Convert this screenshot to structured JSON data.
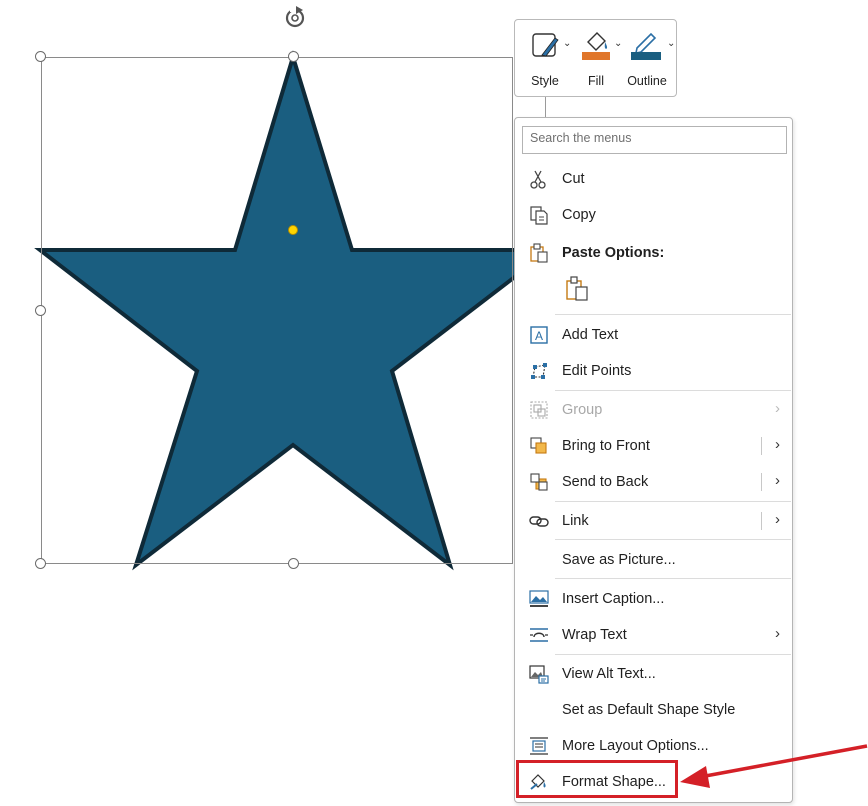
{
  "mini_toolbar": {
    "style_label": "Style",
    "fill_label": "Fill",
    "outline_label": "Outline"
  },
  "menu": {
    "search_placeholder": "Search the menus",
    "items": {
      "cut": "Cut",
      "copy": "Copy",
      "paste_options": "Paste Options:",
      "add_text": "Add Text",
      "edit_points": "Edit Points",
      "group": "Group",
      "bring_to_front": "Bring to Front",
      "send_to_back": "Send to Back",
      "link": "Link",
      "save_as_picture": "Save as Picture...",
      "insert_caption": "Insert Caption...",
      "wrap_text": "Wrap Text",
      "view_alt_text": "View Alt Text...",
      "set_default_shape_style": "Set as Default Shape Style",
      "more_layout_options": "More Layout Options...",
      "format_shape": "Format Shape..."
    }
  },
  "colors": {
    "star_fill": "#1a5e80",
    "star_outline": "#0f2a38",
    "fill_swatch": "#e0762a",
    "outline_swatch": "#1a5e80",
    "highlight": "#d42027"
  }
}
